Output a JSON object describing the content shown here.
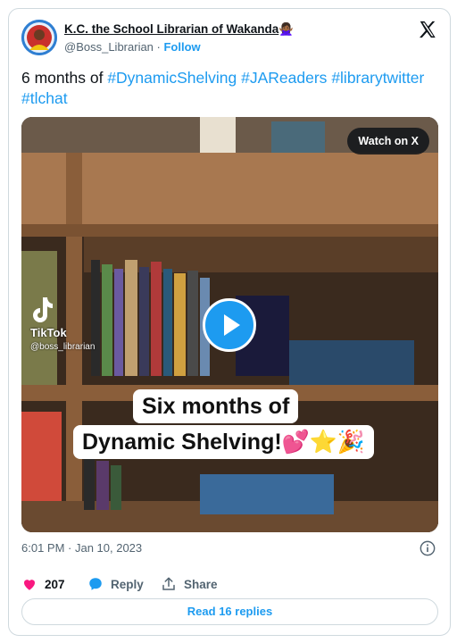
{
  "author": {
    "display_name": "K.C. the School Librarian of Wakanda",
    "name_emoji": "🙅🏾‍♀️",
    "handle": "@Boss_Librarian",
    "separator": " · ",
    "follow_label": "Follow"
  },
  "tweet": {
    "text_lead": "6 months of ",
    "hashtags": [
      "#DynamicShelving",
      "#JAReaders",
      "#librarytwitter",
      "#tlchat"
    ]
  },
  "media": {
    "watch_label": "Watch on X",
    "tiktok_label": "TikTok",
    "tiktok_user": "@boss_librarian",
    "caption_line1": "Six months of",
    "caption_line2": "Dynamic Shelving!💕⭐🎉"
  },
  "timestamp": "6:01 PM · Jan 10, 2023",
  "actions": {
    "like_count": "207",
    "reply_label": "Reply",
    "share_label": "Share"
  },
  "read_replies_label": "Read 16 replies",
  "colors": {
    "accent": "#1d9bf0",
    "like": "#f91880",
    "text": "#0f1419",
    "muted": "#536471",
    "border": "#cfd9de"
  },
  "icons": [
    "x-logo-icon",
    "play-icon",
    "tiktok-icon",
    "info-icon",
    "heart-icon",
    "reply-bubble-icon",
    "share-icon"
  ]
}
